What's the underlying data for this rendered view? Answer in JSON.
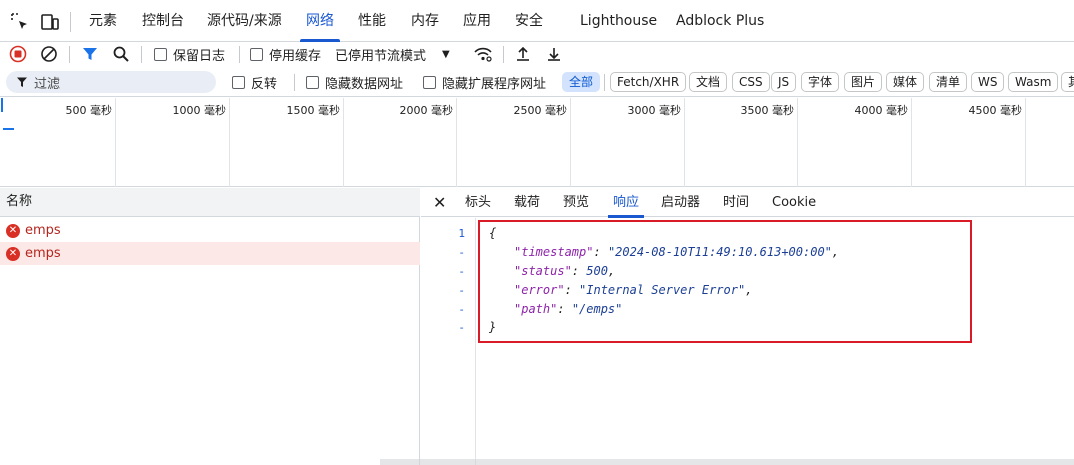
{
  "tabs": [
    {
      "label": "元素"
    },
    {
      "label": "控制台"
    },
    {
      "label": "源代码/来源"
    },
    {
      "label": "网络"
    },
    {
      "label": "性能"
    },
    {
      "label": "内存"
    },
    {
      "label": "应用"
    },
    {
      "label": "安全"
    },
    {
      "label": "Lighthouse"
    },
    {
      "label": "Adblock Plus"
    }
  ],
  "active_tab": "网络",
  "toolbar": {
    "preserve_log_label": "保留日志",
    "disable_cache_label": "停用缓存",
    "throttling_value": "已停用节流模式"
  },
  "filter": {
    "placeholder": "过滤",
    "invert_label": "反转",
    "hide_data_urls_label": "隐藏数据网址",
    "hide_ext_urls_label": "隐藏扩展程序网址",
    "types": [
      "全部",
      "Fetch/XHR",
      "文档",
      "CSS",
      "JS",
      "字体",
      "图片",
      "媒体",
      "清单",
      "WS",
      "Wasm",
      "其"
    ]
  },
  "timeline": {
    "labels": [
      "500 毫秒",
      "1000 毫秒",
      "1500 毫秒",
      "2000 毫秒",
      "2500 毫秒",
      "3000 毫秒",
      "3500 毫秒",
      "4000 毫秒",
      "4500 毫秒"
    ]
  },
  "request_list": {
    "header": "名称",
    "rows": [
      {
        "name": "emps",
        "status": "error"
      },
      {
        "name": "emps",
        "status": "error",
        "selected": true
      }
    ]
  },
  "detail": {
    "tabs": [
      "标头",
      "载荷",
      "预览",
      "响应",
      "启动器",
      "时间",
      "Cookie"
    ],
    "active_tab": "响应",
    "gutter": [
      "1",
      "-",
      "-",
      "-",
      "-",
      "-"
    ],
    "response": {
      "open": "{",
      "timestamp_key": "\"timestamp\"",
      "timestamp_val": "\"2024-08-10T11:49:10.613+00:00\"",
      "status_key": "\"status\"",
      "status_val": "500",
      "error_key": "\"error\"",
      "error_val": "\"Internal Server Error\"",
      "path_key": "\"path\"",
      "path_val": "\"/emps\"",
      "close": "}"
    }
  },
  "colors": {
    "accent": "#1a58d0",
    "error": "#d93025",
    "highlight_border": "#d81b27",
    "selected_row": "#fce8e6"
  }
}
